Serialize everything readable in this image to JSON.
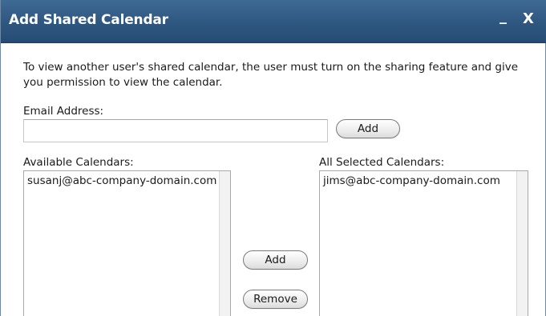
{
  "dialog": {
    "title": "Add Shared Calendar",
    "minimize_label": "_",
    "close_label": "X",
    "description": "To view another user's shared calendar, the user must turn on the sharing feature and give you permission to view the calendar.",
    "email_label": "Email Address:",
    "email_value": "",
    "email_placeholder": "",
    "add_email_button": "Add",
    "available_label": "Available Calendars:",
    "available_items": [
      "susanj@abc-company-domain.com"
    ],
    "selected_label": "All Selected Calendars:",
    "selected_items": [
      "jims@abc-company-domain.com"
    ],
    "add_button": "Add",
    "remove_button": "Remove"
  },
  "colors": {
    "titlebar": "#2e5780",
    "title_text": "#ffffff"
  }
}
